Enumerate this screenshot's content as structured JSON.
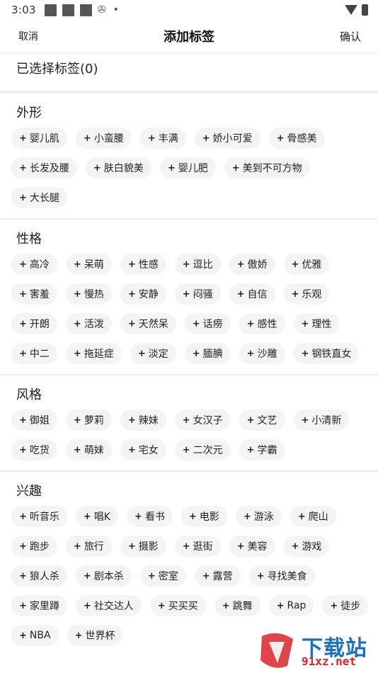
{
  "status_bar": {
    "time": "3:03"
  },
  "header": {
    "cancel_label": "取消",
    "title": "添加标签",
    "confirm_label": "确认"
  },
  "selected": {
    "label": "已选择标签(0)"
  },
  "sections": [
    {
      "title": "外形",
      "tags": [
        "婴儿肌",
        "小蛮腰",
        "丰满",
        "娇小可爱",
        "骨感美",
        "长发及腰",
        "肤白貌美",
        "婴儿肥",
        "美到不可方物",
        "大长腿"
      ]
    },
    {
      "title": "性格",
      "tags": [
        "高冷",
        "呆萌",
        "性感",
        "逗比",
        "傲娇",
        "优雅",
        "害羞",
        "慢热",
        "安静",
        "闷骚",
        "自信",
        "乐观",
        "开朗",
        "活泼",
        "天然呆",
        "话痨",
        "感性",
        "理性",
        "中二",
        "拖延症",
        "淡定",
        "腼腆",
        "沙雕",
        "钢铁直女"
      ]
    },
    {
      "title": "风格",
      "tags": [
        "御姐",
        "萝莉",
        "辣妹",
        "女汉子",
        "文艺",
        "小清新",
        "吃货",
        "萌妹",
        "宅女",
        "二次元",
        "学霸"
      ]
    },
    {
      "title": "兴趣",
      "tags": [
        "听音乐",
        "唱K",
        "看书",
        "电影",
        "游泳",
        "爬山",
        "跑步",
        "旅行",
        "摄影",
        "逛街",
        "美容",
        "游戏",
        "狼人杀",
        "剧本杀",
        "密室",
        "露营",
        "寻找美食",
        "家里蹲",
        "社交达人",
        "买买买",
        "跳舞",
        "Rap",
        "徒步",
        "NBA",
        "世界杯"
      ]
    }
  ],
  "tag_prefix": "+",
  "watermark": {
    "text": "下载站",
    "url": "91xz.net"
  }
}
